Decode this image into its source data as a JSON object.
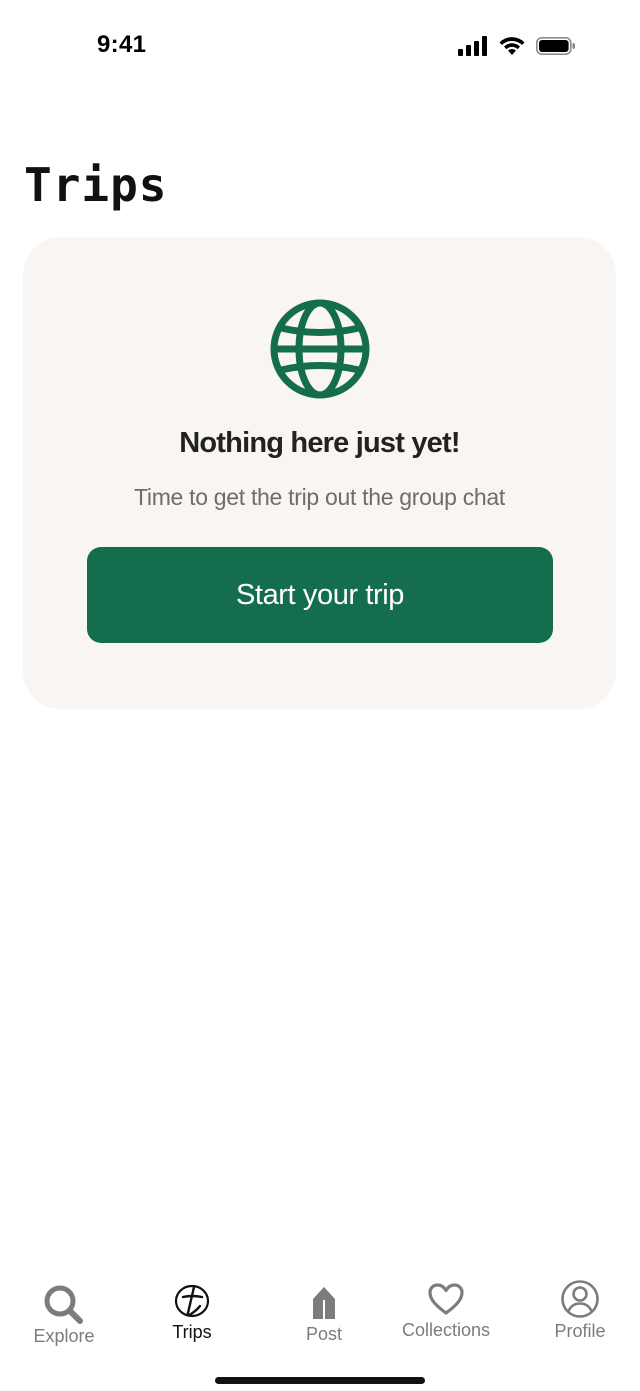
{
  "status_bar": {
    "time": "9:41"
  },
  "page": {
    "title": "Trips"
  },
  "empty_state": {
    "icon": "globe-icon",
    "heading": "Nothing here just yet!",
    "subtitle": "Time to get the trip out the group chat",
    "button_label": "Start your trip"
  },
  "colors": {
    "accent": "#146e4e",
    "card_background": "#f8f5f2",
    "inactive_tab": "#7c7c7c",
    "active_tab": "#111111"
  },
  "tab_bar": {
    "active": "trips",
    "tabs": [
      {
        "id": "explore",
        "label": "Explore",
        "icon": "search-icon"
      },
      {
        "id": "trips",
        "label": "Trips",
        "icon": "trips-logo-icon"
      },
      {
        "id": "post",
        "label": "Post",
        "icon": "pencil-icon"
      },
      {
        "id": "collections",
        "label": "Collections",
        "icon": "heart-icon"
      },
      {
        "id": "profile",
        "label": "Profile",
        "icon": "profile-icon"
      }
    ]
  }
}
